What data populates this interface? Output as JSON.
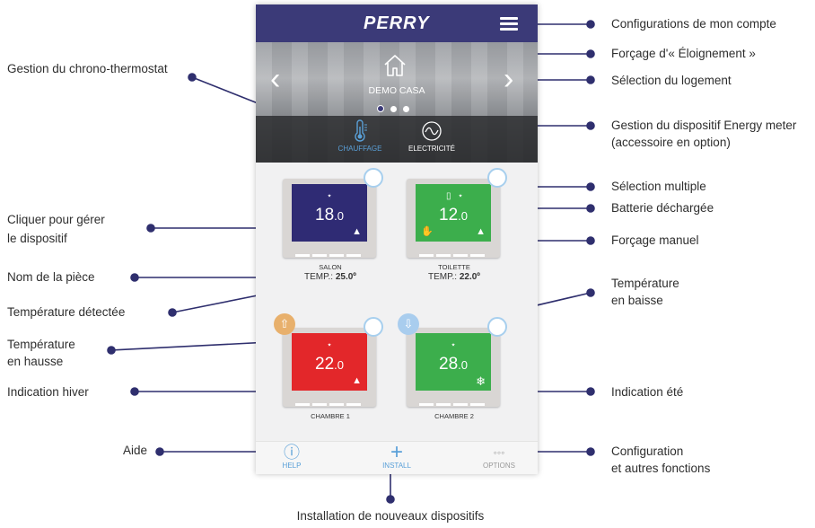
{
  "app": {
    "logo_text": "PERRY",
    "location": "DEMO CASA",
    "tabs": [
      {
        "label": "CHAUFFAGE",
        "icon": "thermometer-icon",
        "active": true
      },
      {
        "label": "ELECTRICITÉ",
        "icon": "energy-meter-icon",
        "active": false
      }
    ],
    "devices": [
      {
        "screen_color": "#2f2b74",
        "wifi": "wifi-icon",
        "temp_int": "18",
        "temp_dec": ".0",
        "mode_icon": "flame-icon",
        "room": "SALON",
        "temp_label": "TEMP.: ",
        "detected_temp": "25.0º"
      },
      {
        "screen_color": "#3cae4c",
        "wifi": "wifi-icon",
        "temp_int": "12",
        "temp_dec": ".0",
        "mode_icon": "flame-icon",
        "battery_icon": "battery-low-icon",
        "manual_icon": "hand-icon",
        "room": "TOILETTE",
        "temp_label": "TEMP.: ",
        "detected_temp": "22.0º"
      },
      {
        "screen_color": "#e3272a",
        "wifi": "wifi-icon",
        "temp_int": "22",
        "temp_dec": ".0",
        "mode_icon": "flame-icon",
        "trend": "up",
        "trend_color": "#e8b06c",
        "room": "CHAMBRE 1"
      },
      {
        "screen_color": "#3cae4c",
        "wifi": "wifi-icon",
        "temp_int": "28",
        "temp_dec": ".0",
        "mode_icon": "snowflake-icon",
        "trend": "down",
        "trend_color": "#a9cdee",
        "room": "CHAMBRE 2"
      }
    ],
    "bottom": {
      "help": "HELP",
      "install": "INSTALL",
      "options": "OPTIONS"
    }
  },
  "annotations": {
    "compte": "Configurations de mon compte",
    "eloignement": "Forçage d'« Éloignement »",
    "logement": "Sélection du logement",
    "energy_1": "Gestion du dispositif Energy meter",
    "energy_2": "(accessoire en option)",
    "multiple": "Sélection multiple",
    "batterie": "Batterie déchargée",
    "manuel": "Forçage manuel",
    "baisse_1": "Température",
    "baisse_2": "en baisse",
    "ete": "Indication été",
    "config_1": "Configuration",
    "config_2": "et autres fonctions",
    "chrono": "Gestion du chrono-thermostat",
    "cliquer_1": "Cliquer pour gérer",
    "cliquer_2": "le dispositif",
    "nom": "Nom de la pièce",
    "detectee": "Température détectée",
    "hausse_1": "Température",
    "hausse_2": "en hausse",
    "hiver": "Indication hiver",
    "aide": "Aide",
    "installation": "Installation de nouveaux dispositifs"
  },
  "colors": {
    "header": "#3b3a78",
    "accent_blue": "#5aa0d8",
    "leader_line": "#2f2f6e"
  }
}
